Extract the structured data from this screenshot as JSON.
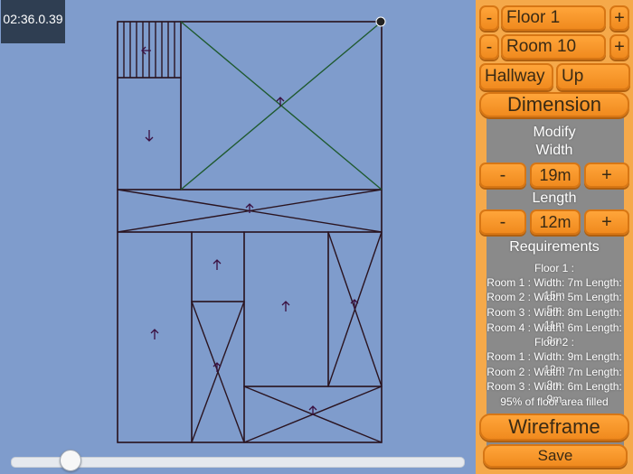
{
  "timer": "02:36.0.39",
  "floor_stepper": {
    "minus": "-",
    "label": "Floor 1",
    "plus": "+"
  },
  "room_stepper": {
    "minus": "-",
    "label": "Room 10",
    "plus": "+"
  },
  "room_type": "Hallway",
  "direction": "Up",
  "dimension_button": "Dimension",
  "modify_label": "Modify",
  "width_label": "Width",
  "width_value": "19m",
  "length_label": "Length",
  "length_value": "12m",
  "requirements_title": "Requirements",
  "requirements": [
    "Floor 1 :",
    "Room 1 : Width: 7m  Length: 15m",
    "Room 2 : Width: 5m  Length: 5m",
    "Room 3 : Width: 8m  Length: 11m",
    "Room 4 : Width: 6m  Length: 8m",
    "Floor 2 :",
    "Room 1 : Width: 9m  Length: 12m",
    "Room 2 : Width: 7m  Length: 8m",
    "Room 3 : Width: 6m  Length: 9m",
    "95% of floor area filled"
  ],
  "wireframe_button": "Wireframe",
  "save_button": "Save",
  "slider_value": 0.13,
  "colors": {
    "panel": "#f5a94a",
    "button": "#f5921f",
    "background": "#7f9ccc",
    "plan_lines": "#2a1420",
    "diagonal_green": "#1f5a2f"
  }
}
